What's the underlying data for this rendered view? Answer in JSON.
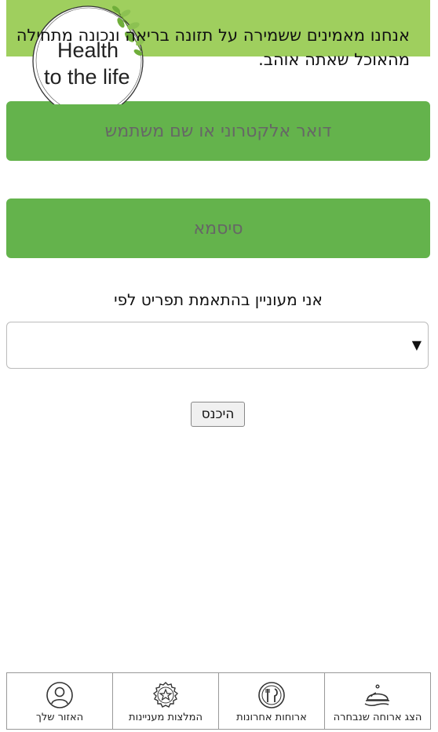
{
  "header": {
    "slogan": "אנחנו מאמינים ששמירה על תזונה בריאה ונכונה מתחילה מהאוכל שאתה אוהב.",
    "logo_line1": "Health",
    "logo_line2": "to the life",
    "banner_color": "#9fcf5e"
  },
  "form": {
    "username_placeholder": "דואר אלקטרוני או שם משתמש",
    "password_placeholder": "סיסמא",
    "preference_label": "אני מעוניין בהתאמת תפריט לפי",
    "preference_selected": "",
    "submit_label": "היכנס",
    "field_color": "#64b34c"
  },
  "bottom_nav": {
    "items": [
      {
        "label": "הצג ארוחה שנבחרה",
        "icon": "serving-cloche-icon"
      },
      {
        "label": "ארוחות אחרונות",
        "icon": "plate-cutlery-icon"
      },
      {
        "label": "המלצות מעניינות",
        "icon": "star-badge-icon"
      },
      {
        "label": "האזור שלך",
        "icon": "user-profile-icon"
      }
    ]
  }
}
